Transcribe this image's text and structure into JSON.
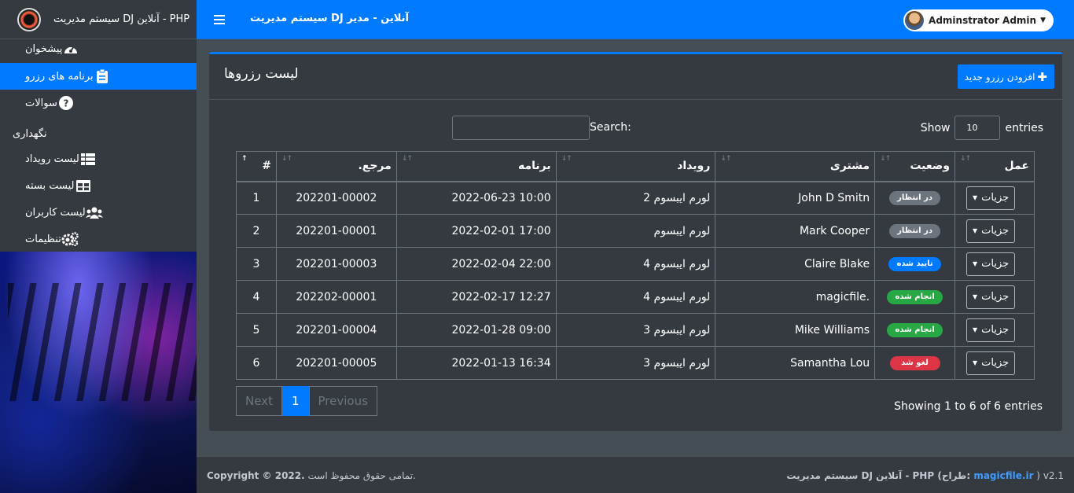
{
  "brand": {
    "title": "PHP - آنلاین DJ سیستم مدیریت"
  },
  "topbar": {
    "title": "آنلاین - مدیر DJ سیستم مدیریت",
    "user_name": "Adminstrator Admin"
  },
  "sidebar": {
    "items": [
      {
        "label": "پیشخوان",
        "icon": "dashboard-icon"
      },
      {
        "label": "برنامه های رزرو",
        "icon": "clipboard-icon",
        "active": true
      },
      {
        "label": "سوالات",
        "icon": "question-icon"
      }
    ],
    "section_title": "نگهداری",
    "maintenance": [
      {
        "label": "لیست رویداد",
        "icon": "list-icon"
      },
      {
        "label": "لیست بسته",
        "icon": "table-icon"
      },
      {
        "label": "لیست کاربران",
        "icon": "users-icon"
      },
      {
        "label": "تنظیمات",
        "icon": "cogs-icon"
      }
    ]
  },
  "card": {
    "title": "لیست رزروها",
    "add_button": "افزودن رزرو جدید"
  },
  "controls": {
    "show": "Show",
    "show_value": "10",
    "entries": "entries",
    "search_label": "Search:"
  },
  "table": {
    "headers": [
      "#",
      "مرجع.",
      "برنامه",
      "رویداد",
      "مشتری",
      "وضعیت",
      "عمل"
    ],
    "rows": [
      {
        "num": "1",
        "ref": "202201-00002",
        "schedule": "2022-06-23 10:00",
        "event": "لورم ایبسوم 2",
        "client": "John D Smitn",
        "status": "در انتظار",
        "status_color": "#6c757d",
        "action": "جزیات"
      },
      {
        "num": "2",
        "ref": "202201-00001",
        "schedule": "2022-02-01 17:00",
        "event": "لورم ایبسوم",
        "client": "Mark Cooper",
        "status": "در انتظار",
        "status_color": "#6c757d",
        "action": "جزیات"
      },
      {
        "num": "3",
        "ref": "202201-00003",
        "schedule": "2022-02-04 22:00",
        "event": "لورم ایبسوم 4",
        "client": "Claire Blake",
        "status": "تایید شده",
        "status_color": "#007bff",
        "action": "جزیات"
      },
      {
        "num": "4",
        "ref": "202202-00001",
        "schedule": "2022-02-17 12:27",
        "event": "لورم ایبسوم 4",
        "client": "magicfile.",
        "status": "انجام شده",
        "status_color": "#28a745",
        "action": "جزیات"
      },
      {
        "num": "5",
        "ref": "202201-00004",
        "schedule": "2022-01-28 09:00",
        "event": "لورم ایبسوم 3",
        "client": "Mike Williams",
        "status": "انجام شده",
        "status_color": "#28a745",
        "action": "جزیات"
      },
      {
        "num": "6",
        "ref": "202201-00005",
        "schedule": "2022-01-13 16:34",
        "event": "لورم ایبسوم 3",
        "client": "Samantha Lou",
        "status": "لغو شد",
        "status_color": "#dc3545",
        "action": "جزیات"
      }
    ]
  },
  "pagination": {
    "info": "Showing 1 to 6 of 6 entries",
    "next": "Next",
    "current": "1",
    "previous": "Previous"
  },
  "footer": {
    "copyright_label": "Copyright © 2022.",
    "rights": "تمامی حقوق محفوظ است.",
    "credit_text": "سیستم مدیریت DJ آنلاین - PHP (طراح: ",
    "credit_link": "magicfile.ir",
    "credit_close": " )",
    "version": "v2.1"
  },
  "colors": {
    "primary": "#007bff",
    "sidebar_bg": "#343a40",
    "content_bg": "#454d55"
  }
}
